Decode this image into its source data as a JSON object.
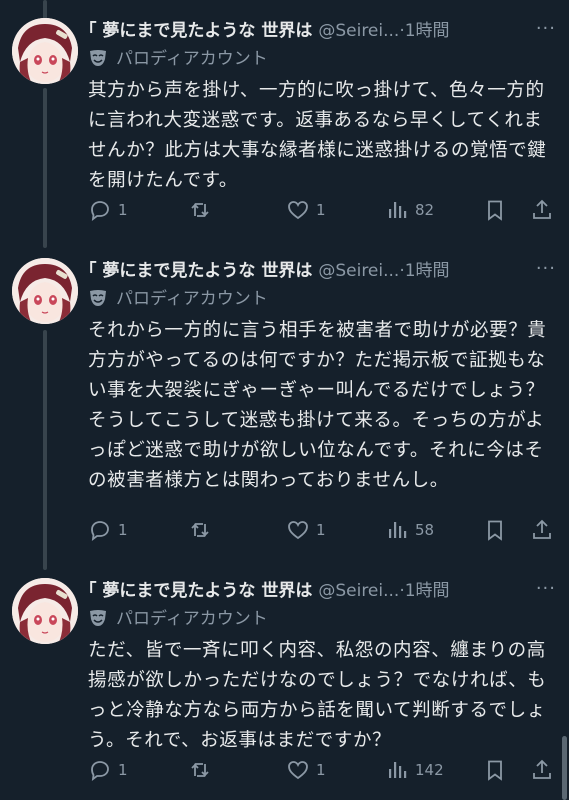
{
  "tweets": [
    {
      "name": "｢ 夢にまで見たような 世界は",
      "handle": "@Seirei...",
      "separator": "·",
      "time": "1時間",
      "more": "···",
      "label": "パロディアカウント",
      "text": "其方から声を掛け、一方的に吹っ掛けて、色々一方的に言われ大変迷惑です。返事あるなら早くしてくれませんか？此方は大事な縁者様に迷惑掛けるの覚悟で鍵を開けたんです。",
      "replies": "1",
      "reposts": "",
      "likes": "1",
      "views": "82"
    },
    {
      "name": "｢ 夢にまで見たような 世界は",
      "handle": "@Seirei...",
      "separator": "·",
      "time": "1時間",
      "more": "···",
      "label": "パロディアカウント",
      "text": "それから一方的に言う相手を被害者で助けが必要？貴方方がやってるのは何ですか？ただ掲示板で証拠もない事を大袈裟にぎゃーぎゃー叫んでるだけでしょう？そうしてこうして迷惑も掛けて来る。そっちの方がよっぽど迷惑で助けが欲しい位なんです。それに今はその被害者様方とは関わっておりませんし。",
      "replies": "1",
      "reposts": "",
      "likes": "1",
      "views": "58"
    },
    {
      "name": "｢ 夢にまで見たような 世界は",
      "handle": "@Seirei...",
      "separator": "·",
      "time": "1時間",
      "more": "···",
      "label": "パロディアカウント",
      "text": "ただ、皆で一斉に叩く内容、私怨の内容、纏まりの高揚感が欲しかっただけなのでしょう？でなければ、もっと冷静な方なら両方から話を聞いて判断するでしょう。それで、お返事はまだですか？",
      "replies": "1",
      "reposts": "",
      "likes": "1",
      "views": "142"
    }
  ],
  "icons": {
    "reply": "reply-icon",
    "repost": "repost-icon",
    "like": "heart-icon",
    "views": "views-icon",
    "bookmark": "bookmark-icon",
    "share": "share-icon",
    "parody": "parody-mask-icon"
  },
  "colors": {
    "background": "#15202b",
    "text": "#e7e9ea",
    "secondary": "#8b98a5",
    "thread_line": "#38444d"
  }
}
